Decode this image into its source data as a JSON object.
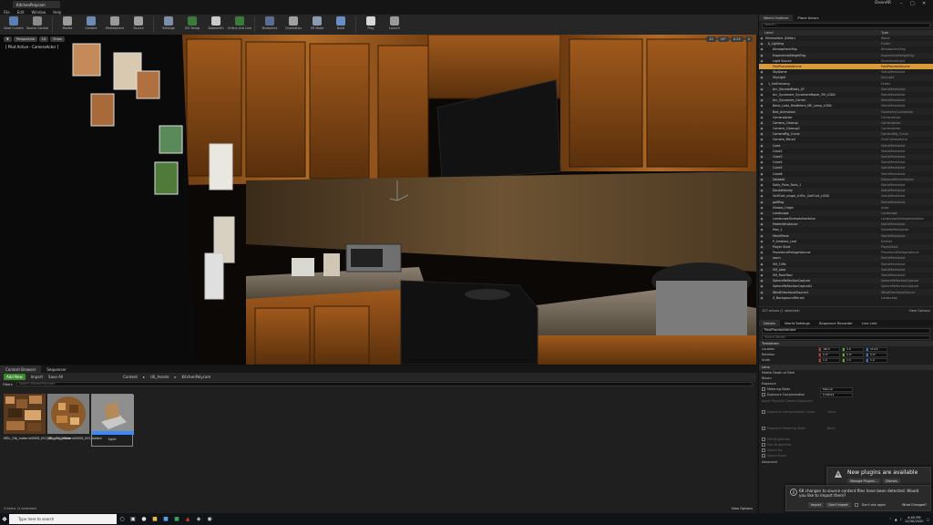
{
  "window": {
    "tab_title": "KitchenPolycam",
    "app_name": "OvenAR"
  },
  "menu": [
    "File",
    "Edit",
    "Window",
    "Help"
  ],
  "toolbar": [
    {
      "label": "Save Current",
      "icon": "save-icon",
      "color": "#5b7fb3"
    },
    {
      "label": "Source Control",
      "icon": "source-control-icon",
      "color": "#8a8a8a"
    },
    {
      "label": "Modes",
      "icon": "modes-icon",
      "color": "#9a9a9a"
    },
    {
      "label": "Content",
      "icon": "content-icon",
      "color": "#6d8ab5"
    },
    {
      "label": "Marketplace",
      "icon": "marketplace-icon",
      "color": "#9a9a9a"
    },
    {
      "label": "Source",
      "icon": "source-icon",
      "color": "#a0a0a0"
    },
    {
      "label": "Settings",
      "icon": "settings-icon",
      "color": "#7c8ea8"
    },
    {
      "label": "ZIV Setup",
      "icon": "ziv-setup-icon",
      "color": "#3c7a3c"
    },
    {
      "label": "Datasmith",
      "icon": "datasmith-icon",
      "color": "#c9c9c9"
    },
    {
      "label": "Online Link Link",
      "icon": "online-link-icon",
      "color": "#3c7a3c"
    },
    {
      "label": "Blueprints",
      "icon": "blueprints-icon",
      "color": "#5a6f8f"
    },
    {
      "label": "Cinematics",
      "icon": "cinematics-icon",
      "color": "#a0a0a0"
    },
    {
      "label": "VR Mode",
      "icon": "vr-mode-icon",
      "color": "#8a9ab0"
    },
    {
      "label": "Build",
      "icon": "build-icon",
      "color": "#6a8ec8"
    },
    {
      "label": "Play",
      "icon": "play-icon",
      "color": "#d8d8d8"
    },
    {
      "label": "Launch",
      "icon": "launch-icon",
      "color": "#9a9a9a"
    }
  ],
  "viewport": {
    "chips": [
      "Perspective",
      "Lit",
      "Show"
    ],
    "status": "[ Pilot Active - CameraActor ]",
    "right_chips": [
      "10",
      "10°",
      "0.25",
      "4"
    ]
  },
  "content_browser": {
    "tabs": [
      "Content Browser",
      "Sequencer"
    ],
    "add_new": "Add New",
    "import": "Import",
    "save_all": "Save All",
    "path": [
      "Content",
      "UE_Assets",
      "KitchenPolycam"
    ],
    "filters": "Filters",
    "search_placeholder": "Search KitchenPolycam",
    "assets": [
      {
        "name": "MDL_Obj_material0008_001_lib_plst_diffuse"
      },
      {
        "name": "MDL_Obj_material0008_001_baked"
      },
      {
        "name": "Sgrid"
      }
    ],
    "status": "3 items (1 selected)",
    "view_options": "View Options"
  },
  "outliner": {
    "tabs": [
      "World Outliner",
      "Place Actors"
    ],
    "search_placeholder": "Search...",
    "col_label": "Label",
    "col_type": "Type",
    "rows": [
      {
        "label": "Minimalistic (Editor)",
        "type": "World"
      },
      {
        "label": "0_Lighting",
        "type": "Folder"
      },
      {
        "label": "AtmosphericFog",
        "type": "AtmosphericFog"
      },
      {
        "label": "ExponentialHeightFog",
        "type": "ExponentialHeightFog"
      },
      {
        "label": "Light Source",
        "type": "DirectionalLight"
      },
      {
        "label": "PostProcessVolume",
        "type": "PostProcessVolume",
        "selected": true
      },
      {
        "label": "SkyDome",
        "type": "StaticMeshActor"
      },
      {
        "label": "SkyLight",
        "type": "SkyLight"
      },
      {
        "label": "1_SetDressing",
        "type": "Folder"
      },
      {
        "label": "Arc_SecuredBasis_LP",
        "type": "StaticMeshActor"
      },
      {
        "label": "Arc_Sycamore_SycamoreMaple_3M_LOD0",
        "type": "StaticMeshActor"
      },
      {
        "label": "Arc_Sycamore_Corner",
        "type": "StaticMeshActor"
      },
      {
        "label": "Basic_Lodo_ResBefore_ME_Lamp_LOD0",
        "type": "StaticMeshActor"
      },
      {
        "label": "Bed_Animation",
        "type": "GeometryCacheActor"
      },
      {
        "label": "CameraActor",
        "type": "CameraActor"
      },
      {
        "label": "Camera_Closeup",
        "type": "CameraActor"
      },
      {
        "label": "Camera_Closeup2",
        "type": "CameraActor"
      },
      {
        "label": "CameraRig_Crane",
        "type": "CameraRig_Crane"
      },
      {
        "label": "Camera_Mount",
        "type": "CineCameraActor"
      },
      {
        "label": "Cube",
        "type": "StaticMeshActor"
      },
      {
        "label": "Cube2",
        "type": "StaticMeshActor"
      },
      {
        "label": "Cube3",
        "type": "StaticMeshActor"
      },
      {
        "label": "Cube4",
        "type": "StaticMeshActor"
      },
      {
        "label": "Cube5",
        "type": "StaticMeshActor"
      },
      {
        "label": "Cube6",
        "type": "StaticMeshActor"
      },
      {
        "label": "Databot",
        "type": "DatasmithSceneActor"
      },
      {
        "label": "Dolly_Palm_Rock_1",
        "type": "StaticMeshActor"
      },
      {
        "label": "DoubleVanity",
        "type": "StaticMeshActor"
      },
      {
        "label": "GolfCart_single_LOEtc_GolfCart_LOD0",
        "type": "StaticMeshActor"
      },
      {
        "label": "golfflag",
        "type": "StaticMeshActor"
      },
      {
        "label": "IGlobal_Origin",
        "type": "Actor"
      },
      {
        "label": "Landscape",
        "type": "Landscape"
      },
      {
        "label": "LandscapeGizmoActiveActor",
        "type": "LandscapeGizmoActiveActor"
      },
      {
        "label": "MaterialInstance",
        "type": "StaticMeshActor"
      },
      {
        "label": "Man_1",
        "type": "SkeletalMeshActor"
      },
      {
        "label": "MeshPlane",
        "type": "StaticMeshActor"
      },
      {
        "label": "P_Ambient_Leaf",
        "type": "Emitter"
      },
      {
        "label": "Player Start",
        "type": "PlayerStart"
      },
      {
        "label": "ProceduralFoliageVolume",
        "type": "ProceduralFoliageVolume"
      },
      {
        "label": "room",
        "type": "StaticMeshActor"
      },
      {
        "label": "SM_Cliffs",
        "type": "StaticMeshActor"
      },
      {
        "label": "SM_Lake",
        "type": "StaticMeshActor"
      },
      {
        "label": "SM_Rockfloor",
        "type": "StaticMeshActor"
      },
      {
        "label": "SphereReflectionCapture",
        "type": "SphereReflectionCapture"
      },
      {
        "label": "SphereReflectionCapture2",
        "type": "SphereReflectionCapture"
      },
      {
        "label": "WindDirectionalSource1",
        "type": "WindDirectionalSource"
      },
      {
        "label": "Z_BackgroundTerrain",
        "type": "Landscape"
      }
    ],
    "footer_count": "107 actors (1 selected)",
    "footer_view": "View Options"
  },
  "details": {
    "tabs": [
      "Details",
      "World Settings",
      "Sequence Recorder",
      "Live Link"
    ],
    "actor_name": "PostProcessVolume",
    "search_placeholder": "Search Details",
    "transform_header": "Transform",
    "location_label": "Location",
    "rotation_label": "Rotation",
    "scale_label": "Scale",
    "location": [
      "-66.0",
      "3.0",
      "114.0"
    ],
    "rotation": [
      "0.0°",
      "0.0°",
      "0.0°"
    ],
    "scale": [
      "1.0",
      "1.0",
      "1.0"
    ],
    "lens_header": "Lens",
    "mobile_dof": "Mobile Depth of Field",
    "bloom": "Bloom",
    "exposure_header": "Exposure",
    "metering_mode_label": "Metering Mode",
    "metering_mode_value": "Manual",
    "exposure_comp_label": "Exposure Compensation",
    "exposure_comp_value": "0.00014",
    "apply_physical": "Apply Physical Camera Exposure",
    "exposure_comp_curve": "Exposure Compensation Curve",
    "exposure_metering_mask": "Exposure Metering Mask",
    "none_label": "None",
    "min_brightness": "Min Brightness",
    "max_brightness": "Max Brightness",
    "speed_up": "Speed Up",
    "speed_down": "Speed Down",
    "advanced": "Advanced"
  },
  "notifications": {
    "plugins_title": "New plugins are available",
    "manage_plugins": "Manage Plugins...",
    "dismiss": "Dismiss",
    "changes_text": "68 changes to source content files have been detected. Would you like to import them?",
    "import": "Import",
    "dont_import": "Don't Import",
    "dont_ask": "Don't ask again",
    "what_changed": "What Changed?"
  },
  "taskbar": {
    "search_placeholder": "Type here to search",
    "time": "4:45 PM",
    "date": "12/30/2020"
  }
}
